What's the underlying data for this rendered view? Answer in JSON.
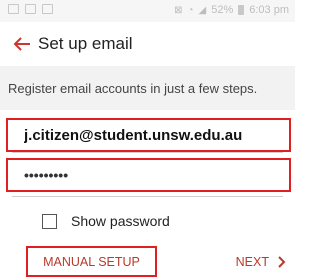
{
  "status_bar": {
    "battery": "52%",
    "time": "6:03 pm",
    "icons": [
      "gallery-icon",
      "image-icon",
      "notification-icon",
      "mute-icon",
      "wifi-icon",
      "signal-icon",
      "battery-icon"
    ]
  },
  "app_bar": {
    "title": "Set up email",
    "back_icon": "arrow-left-icon"
  },
  "intro": {
    "text": "Register email accounts in just a few steps."
  },
  "form": {
    "email_value": "j.citizen@student.unsw.edu.au",
    "password_value": "•••••••••",
    "show_password_label": "Show password",
    "show_password_checked": false
  },
  "footer": {
    "manual_setup_label": "MANUAL SETUP",
    "next_label": "NEXT",
    "next_icon": "chevron-right-icon"
  },
  "colors": {
    "accent": "#b83a2a",
    "highlight": "#e02020",
    "background_gray": "#f2f2f2"
  }
}
